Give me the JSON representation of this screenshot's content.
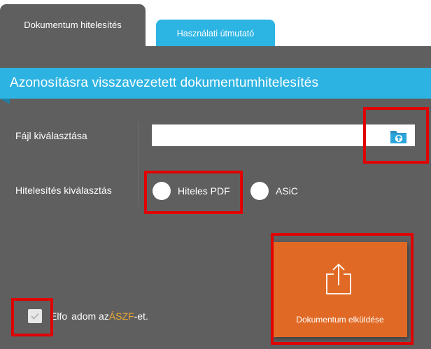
{
  "tabs": {
    "active": "Dokumentum hitelesítés",
    "help": "Használati útmutató"
  },
  "banner": {
    "title": "Azonosításra visszavezetett dokumentumhitelesítés"
  },
  "form": {
    "file_label": "Fájl kiválasztása",
    "file_value": "",
    "cert_label": "Hitelesítés kiválasztás",
    "options": [
      "Hiteles PDF",
      "ASiC"
    ],
    "submit_label": "Dokumentum elküldése",
    "accept_prefix": "Elfo",
    "accept_mid": "adom az ",
    "accept_link": "ÁSZF",
    "accept_suffix": "-et."
  },
  "icons": {
    "folder": "folder-upload-icon",
    "upload": "upload-icon",
    "check": "check-icon"
  },
  "colors": {
    "panel": "#5f5f5f",
    "accent_blue": "#2db3e2",
    "submit_orange": "#e06a25",
    "link_orange": "#f0a830",
    "highlight_red": "#e00000"
  }
}
